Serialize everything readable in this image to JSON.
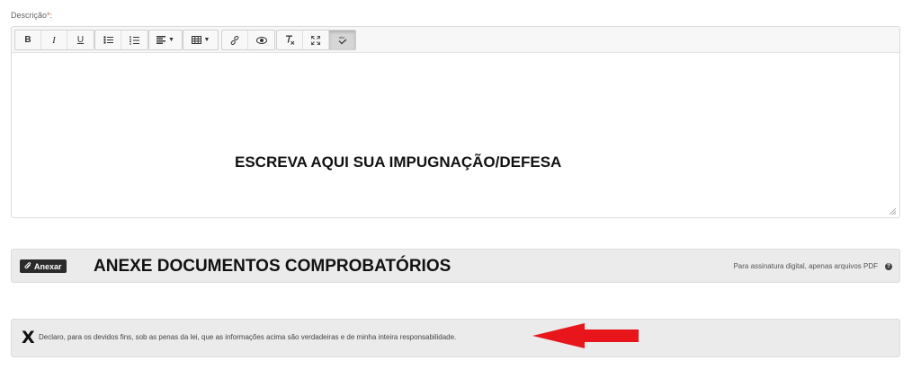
{
  "form": {
    "description_label": "Descrição",
    "required_mark": "*",
    "label_colon": ":"
  },
  "toolbar": {
    "bold": "B",
    "italic": "I",
    "underline": "U",
    "icons": [
      "bold-icon",
      "italic-icon",
      "underline-icon",
      "bullet-list-icon",
      "numbered-list-icon",
      "align-icon",
      "table-icon",
      "link-icon",
      "eye-icon",
      "clear-format-icon",
      "fullscreen-icon",
      "html-source-icon"
    ]
  },
  "editor": {
    "content": "ESCREVA AQUI SUA IMPUGNAÇÃO/DEFESA"
  },
  "attach": {
    "button_label": "Anexar",
    "heading": "ANEXE DOCUMENTOS COMPROBATÓRIOS",
    "hint": "Para assinatura digital, apenas arquivos PDF"
  },
  "declaration": {
    "mark": "X",
    "text": "Declaro, para os devidos fins, sob as penas da lei, que as informações acima são verdadeiras e de minha inteira responsabilidade."
  },
  "colors": {
    "arrow": "#e8151b",
    "required": "#d9534f",
    "attach_button": "#2b2b2b"
  }
}
